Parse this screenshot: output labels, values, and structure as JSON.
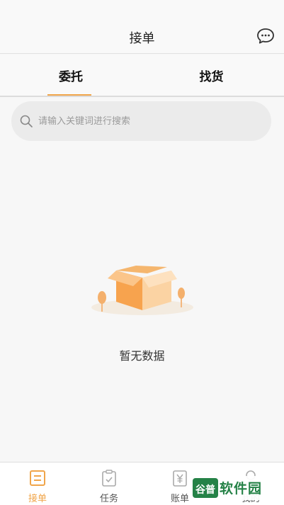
{
  "header": {
    "title": "接单",
    "chat_icon": "chat-bubble-icon"
  },
  "tabs": [
    {
      "label": "委托",
      "active": true
    },
    {
      "label": "找货",
      "active": false
    }
  ],
  "search": {
    "placeholder": "请输入关键词进行搜索",
    "value": "",
    "icon": "search-icon"
  },
  "empty_state": {
    "text": "暂无数据",
    "illustration": "empty-box-icon"
  },
  "bottom_nav": {
    "items": [
      {
        "label": "接单",
        "icon": "order-list-icon",
        "active": true
      },
      {
        "label": "任务",
        "icon": "clipboard-check-icon",
        "active": false
      },
      {
        "label": "账单",
        "icon": "yuan-bill-icon",
        "active": false
      },
      {
        "label": "我的",
        "icon": "profile-icon",
        "active": false
      }
    ]
  },
  "watermark": {
    "text": "软件园",
    "logo_text": "谷普"
  },
  "colors": {
    "accent": "#f0a54a",
    "background": "#f7f7f7",
    "watermark": "#1a7c3e"
  }
}
